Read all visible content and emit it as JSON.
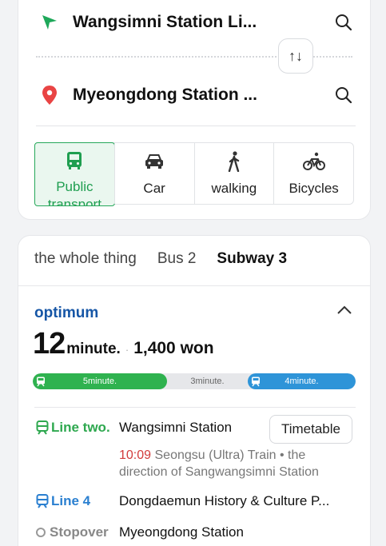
{
  "origin": {
    "text": "Wangsimni Station Li...",
    "icon": "location-arrow-icon",
    "color": "#1ea85a"
  },
  "destination": {
    "text": "Myeongdong Station ...",
    "icon": "map-pin-icon",
    "color": "#e94444"
  },
  "swap_label": "↑↓",
  "modes": [
    {
      "label": "Public transport",
      "icon": "bus-icon",
      "active": true
    },
    {
      "label": "Car",
      "icon": "car-icon",
      "active": false
    },
    {
      "label": "walking",
      "icon": "walking-icon",
      "active": false
    },
    {
      "label": "Bicycles",
      "icon": "bicycle-icon",
      "active": false
    }
  ],
  "filters": [
    {
      "label": "the whole thing",
      "active": false
    },
    {
      "label": "Bus 2",
      "active": false
    },
    {
      "label": "Subway 3",
      "active": true
    }
  ],
  "route": {
    "optimum_label": "optimum",
    "time_value": "12",
    "time_unit": "minute.",
    "separator": "·",
    "fare": "1,400 won",
    "segments": [
      {
        "label": "5minute.",
        "type": "subway",
        "color": "#2fb24f",
        "fraction": 0.4167
      },
      {
        "label": "3minute.",
        "type": "walk",
        "color": "#e6e7ea",
        "fraction": 0.25
      },
      {
        "label": "4minute.",
        "type": "subway",
        "color": "#2e94d8",
        "fraction": 0.3333
      }
    ],
    "steps": [
      {
        "line": "Line two.",
        "station": "Wangsimni Station",
        "color": "#2ea84f"
      },
      {
        "line": "Line 4",
        "station": "Dongdaemun History & Culture P...",
        "color": "#2a7fd0"
      },
      {
        "line": "Stopover",
        "station": "Myeongdong Station",
        "color": "#888888"
      }
    ],
    "timetable_label": "Timetable",
    "train_time": "10:09",
    "train_desc": "Seongsu (Ultra) Train • the direction of Sangwangsimni Station"
  }
}
